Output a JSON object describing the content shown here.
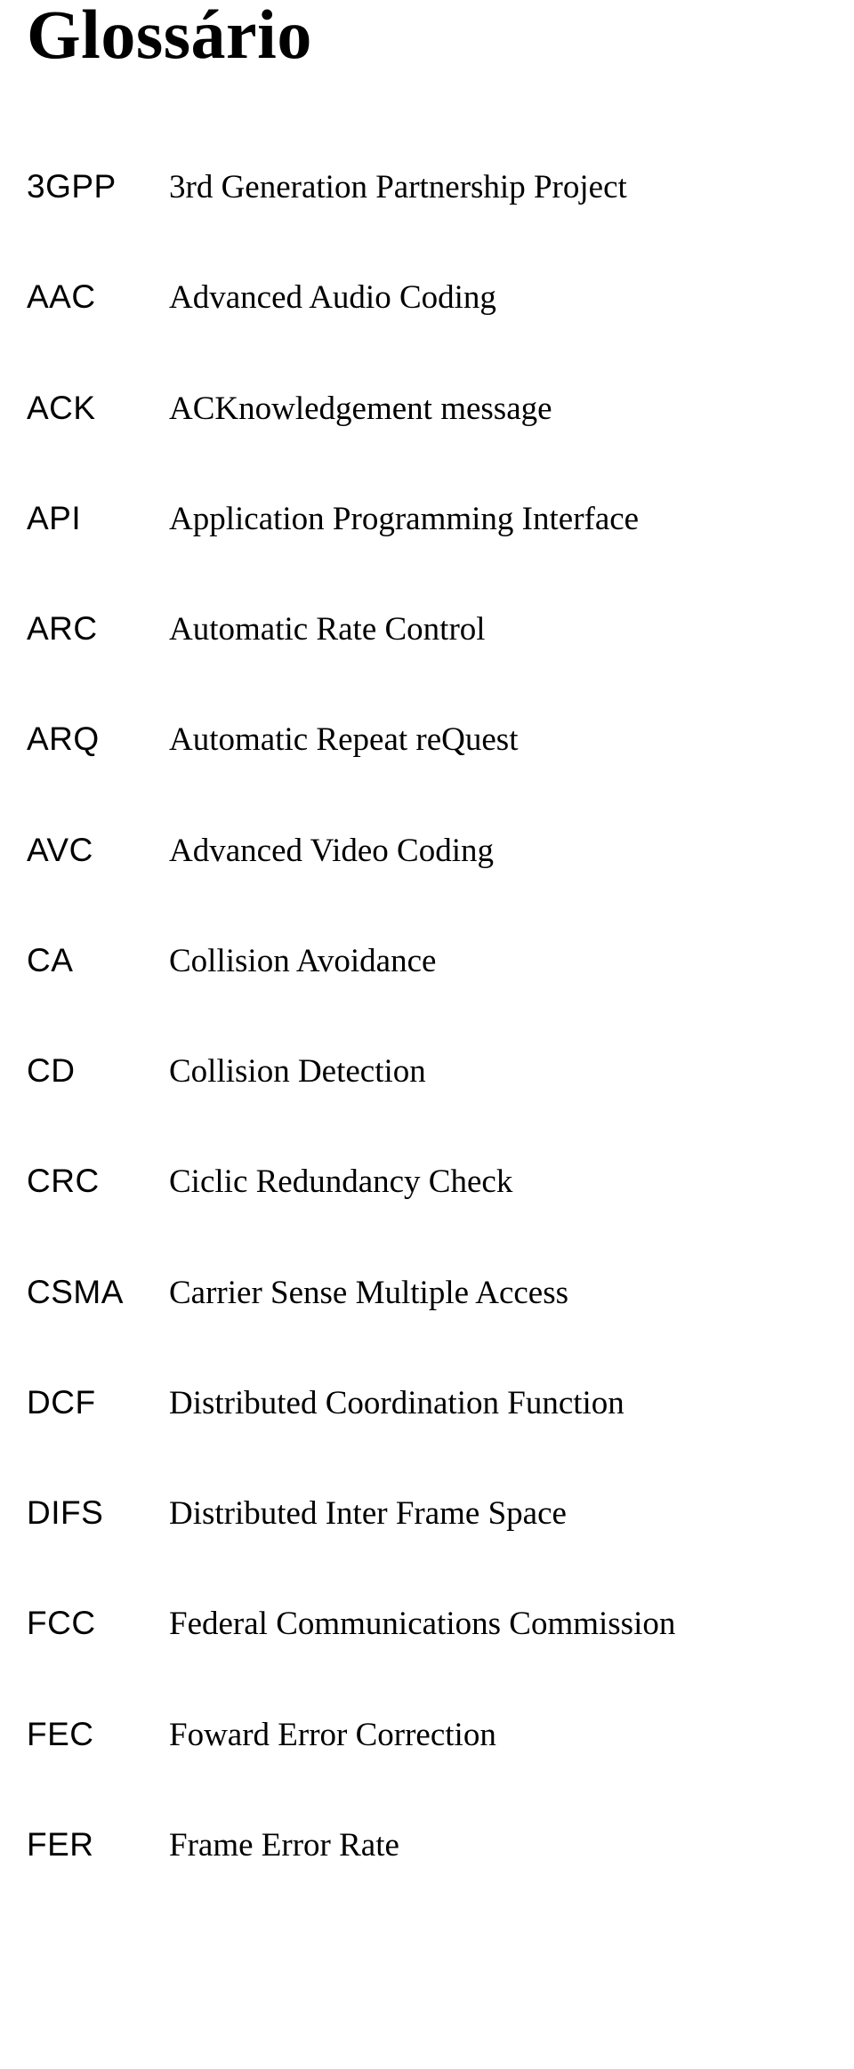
{
  "title": "Glossário",
  "entries": [
    {
      "term": "3GPP",
      "definition": "3rd Generation Partnership Project"
    },
    {
      "term": "AAC",
      "definition": "Advanced Audio Coding"
    },
    {
      "term": "ACK",
      "definition": "ACKnowledgement message"
    },
    {
      "term": "API",
      "definition": "Application Programming Interface"
    },
    {
      "term": "ARC",
      "definition": "Automatic Rate Control"
    },
    {
      "term": "ARQ",
      "definition": "Automatic Repeat reQuest"
    },
    {
      "term": "AVC",
      "definition": "Advanced Video Coding"
    },
    {
      "term": "CA",
      "definition": "Collision Avoidance"
    },
    {
      "term": "CD",
      "definition": "Collision Detection"
    },
    {
      "term": "CRC",
      "definition": "Ciclic Redundancy Check"
    },
    {
      "term": "CSMA",
      "definition": "Carrier Sense Multiple Access"
    },
    {
      "term": "DCF",
      "definition": "Distributed Coordination Function"
    },
    {
      "term": "DIFS",
      "definition": "Distributed Inter Frame Space"
    },
    {
      "term": "FCC",
      "definition": "Federal Communications Commission"
    },
    {
      "term": "FEC",
      "definition": "Foward Error Correction"
    },
    {
      "term": "FER",
      "definition": "Frame Error Rate"
    }
  ]
}
